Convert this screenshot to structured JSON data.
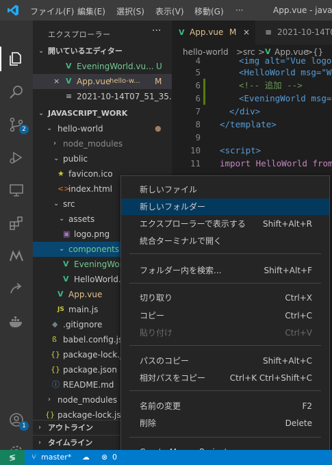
{
  "menu": [
    "ファイル(F)",
    "編集(E)",
    "選択(S)",
    "表示(V)",
    "移動(G)",
    "···"
  ],
  "window_title": "App.vue - javascr",
  "activity_badges": {
    "source_control": "2",
    "accounts": "1"
  },
  "sidebar": {
    "title": "エクスプローラー",
    "more": "···",
    "open_editors": {
      "label": "開いているエディター",
      "items": [
        {
          "name": "EveningWorld.vu...",
          "status": "U"
        },
        {
          "name": "App.vue",
          "dir": "hello-w...",
          "status": "M"
        },
        {
          "name": "2021-10-14T07_51_35..."
        }
      ]
    },
    "workspace": "JAVASCRIPT_WORK",
    "tree": {
      "hello_world": "hello-world",
      "node_modules": "node_modules",
      "public": "public",
      "favicon": "favicon.ico",
      "index_html": "index.html",
      "src": "src",
      "assets": "assets",
      "logo": "logo.png",
      "components": "components",
      "evening": "EveningWor",
      "hello": "HelloWorld.",
      "app": "App.vue",
      "main_js": "main.js",
      "gitignore": ".gitignore",
      "babel": "babel.config.js",
      "pkg_lock": "package-lock.js",
      "pkg": "package.json",
      "readme": "README.md",
      "node_modules2": "node_modules",
      "pkg_lock2": "package-lock.json"
    },
    "outline": "アウトライン",
    "timeline": "タイムライン"
  },
  "tabs": [
    {
      "label": "App.vue",
      "status": "M",
      "close": "×"
    },
    {
      "label": "2021-10-14T0"
    }
  ],
  "breadcrumb": [
    "hello-world",
    ">",
    "src",
    ">",
    "App.vue",
    ">",
    "{}"
  ],
  "code_lines": [
    {
      "n": "4",
      "text": "<img alt=\"Vue logo\""
    },
    {
      "n": "5",
      "text": "<HelloWorld msg=\"W"
    },
    {
      "n": "6",
      "text": "<!-- 追加 -->"
    },
    {
      "n": "6",
      "text": "<EveningWorld msg="
    },
    {
      "n": "7",
      "text": "</div>"
    },
    {
      "n": "8",
      "text": "</template>"
    },
    {
      "n": "9",
      "text": ""
    },
    {
      "n": "10",
      "text": "<script>"
    },
    {
      "n": "11",
      "text": "import HelloWorld from"
    }
  ],
  "context_menu": [
    {
      "label": "新しいファイル",
      "shortcut": ""
    },
    {
      "label": "新しいフォルダー",
      "shortcut": "",
      "active": true
    },
    {
      "label": "エクスプローラーで表示する",
      "shortcut": "Shift+Alt+R"
    },
    {
      "label": "統合ターミナルで開く",
      "shortcut": ""
    },
    {
      "label": "フォルダー内を検索...",
      "shortcut": "Shift+Alt+F"
    },
    {
      "label": "切り取り",
      "shortcut": "Ctrl+X"
    },
    {
      "label": "コピー",
      "shortcut": "Ctrl+C"
    },
    {
      "label": "貼り付け",
      "shortcut": "Ctrl+V",
      "disabled": true
    },
    {
      "label": "パスのコピー",
      "shortcut": "Shift+Alt+C"
    },
    {
      "label": "相対パスをコピー",
      "shortcut": "Ctrl+K Ctrl+Shift+C"
    },
    {
      "label": "名前の変更",
      "shortcut": "F2"
    },
    {
      "label": "削除",
      "shortcut": "Delete"
    },
    {
      "label": "Create Maven Project",
      "shortcut": ""
    }
  ],
  "status": {
    "branch": "master*",
    "errors": "0"
  },
  "colors": {
    "status_bar": "#007acc",
    "remote": "#16825d",
    "selection": "#094771",
    "vue": "#41b883"
  }
}
